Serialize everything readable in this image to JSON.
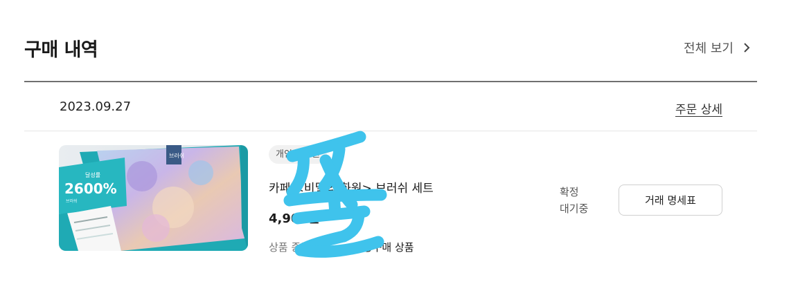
{
  "header": {
    "title": "구매 내역",
    "view_all_label": "전체 보기"
  },
  "order": {
    "date": "2023.09.27",
    "detail_link": "주문 상세"
  },
  "item": {
    "badge": "개인 사용권",
    "title": "카페 <비밀의 화원> 브러쉬 세트",
    "price": "4,900원",
    "type_label": "상품 종류",
    "type_value": "공동구매 상품",
    "thumbnail": {
      "promo_small": "달성률",
      "promo_big": "2600%",
      "promo_caption": "브러쉬",
      "box_tag": "브러쉬"
    }
  },
  "status": {
    "line1": "확정",
    "line2": "대기중"
  },
  "receipt_button_label": "거래 명세표",
  "watermark": {
    "glyph": "꿀",
    "color": "#3fc3ec"
  },
  "colors": {
    "teal_accent": "#1faab4",
    "heading": "#1a1a1a"
  }
}
